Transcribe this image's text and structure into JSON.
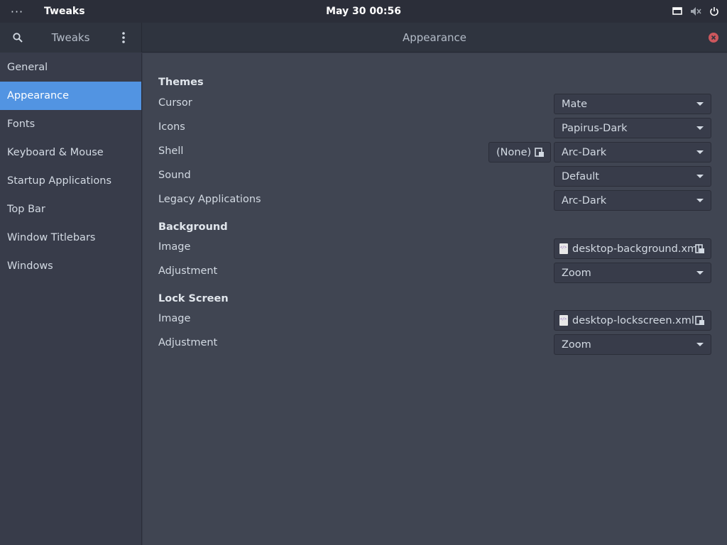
{
  "topbar": {
    "activities_glyph": "···",
    "app_name": "Tweaks",
    "clock": "May 30  00:56"
  },
  "headerbar": {
    "sidebar_title": "Tweaks",
    "page_title": "Appearance"
  },
  "sidebar": {
    "items": [
      {
        "label": "General"
      },
      {
        "label": "Appearance"
      },
      {
        "label": "Fonts"
      },
      {
        "label": "Keyboard & Mouse"
      },
      {
        "label": "Startup Applications"
      },
      {
        "label": "Top Bar"
      },
      {
        "label": "Window Titlebars"
      },
      {
        "label": "Windows"
      }
    ],
    "active_index": 1
  },
  "themes": {
    "title": "Themes",
    "cursor": {
      "label": "Cursor",
      "value": "Mate"
    },
    "icons": {
      "label": "Icons",
      "value": "Papirus-Dark"
    },
    "shell": {
      "label": "Shell",
      "file_value": "(None)",
      "value": "Arc-Dark"
    },
    "sound": {
      "label": "Sound",
      "value": "Default"
    },
    "legacy": {
      "label": "Legacy Applications",
      "value": "Arc-Dark"
    }
  },
  "background": {
    "title": "Background",
    "image": {
      "label": "Image",
      "value": "desktop-background.xml"
    },
    "adjustment": {
      "label": "Adjustment",
      "value": "Zoom"
    }
  },
  "lockscreen": {
    "title": "Lock Screen",
    "image": {
      "label": "Image",
      "value": "desktop-lockscreen.xml"
    },
    "adjustment": {
      "label": "Adjustment",
      "value": "Zoom"
    }
  },
  "colors": {
    "accent": "#5294e2",
    "close": "#cc575d",
    "panel": "#2b2e39",
    "content": "#404552"
  }
}
